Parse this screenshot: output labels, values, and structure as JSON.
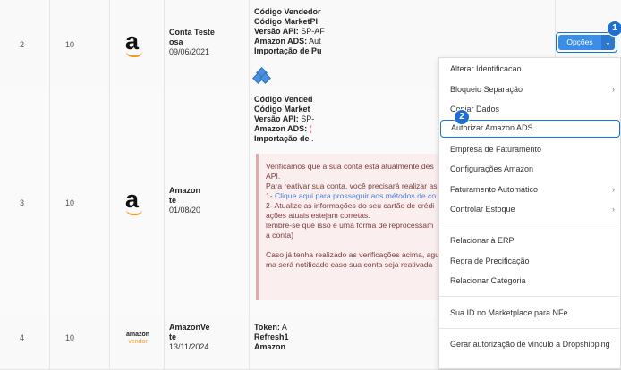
{
  "rows": [
    {
      "index": "2",
      "num": "10",
      "logo": "amazon-a",
      "account": {
        "name1": "Conta Teste",
        "name2": "osa",
        "date": "09/06/2021"
      },
      "info": [
        {
          "label": "Código Vendedor",
          "value": ""
        },
        {
          "label": "Código MarketPl",
          "value": ""
        },
        {
          "label": "Versão API:",
          "value": " SP-AF"
        },
        {
          "label": "Amazon ADS:",
          "value": " Aut"
        },
        {
          "label": "Importação de Pu",
          "value": ""
        }
      ]
    },
    {
      "index": "3",
      "num": "10",
      "logo": "amazon-a",
      "account": {
        "name1": "Amazon",
        "name2": "te",
        "date": "01/08/20"
      },
      "info": [
        {
          "label": "Código Vended",
          "value": ""
        },
        {
          "label": "Código Market",
          "value": ""
        },
        {
          "label": "Versão API:",
          "value": " SP-"
        },
        {
          "label": "Amazon ADS:",
          "value": " ("
        },
        {
          "label": "Importação de ",
          "value": "."
        }
      ],
      "warning": [
        "Verificamos que a sua conta está atualmente des",
        "API.",
        "Para reativar sua conta, você precisará realizar as",
        "1- |Clique aqui para prosseguir aos métodos de co",
        "2- Atualize as informações do seu cartão de crédi",
        "ações atuais estejam corretas.",
        "lembre-se que isso é uma forma de reprocessam",
        "a conta)",
        "",
        "Caso já tenha realizado as verificações acima, agu",
        "ma será notificado caso sua conta seja reativada"
      ]
    },
    {
      "index": "4",
      "num": "10",
      "logo": "amazon-vendor",
      "logo_text": {
        "top": "amazon",
        "bottom": "vendor"
      },
      "account": {
        "name1": "AmazonVe",
        "name2": "te",
        "date": "13/11/2024"
      },
      "info": [
        {
          "label": "Token:",
          "value": " A"
        },
        {
          "label": "Refresh1",
          "value": ""
        },
        {
          "label": "Amazon",
          "value": ""
        }
      ]
    }
  ],
  "options_button": {
    "label": "Opções",
    "caret": "⌄"
  },
  "badges": {
    "one": "1",
    "two": "2"
  },
  "menu": {
    "items": [
      {
        "label": "Alterar Identificacao",
        "submenu": false
      },
      {
        "label": "Bloqueio Separação",
        "submenu": true
      },
      {
        "label": "Copiar Dados",
        "submenu": false
      },
      {
        "label": "Autorizar Amazon ADS",
        "submenu": false,
        "highlighted": true
      },
      {
        "label": "Empresa de Faturamento",
        "submenu": false
      },
      {
        "label": "Configurações Amazon",
        "submenu": false
      },
      {
        "label": "Faturamento Automático",
        "submenu": true
      },
      {
        "label": "Controlar Estoque",
        "submenu": true
      },
      {
        "label": "Relacionar à ERP",
        "submenu": false
      },
      {
        "label": "Regra de Precificação",
        "submenu": false
      },
      {
        "label": "Relacionar Categoria",
        "submenu": false
      },
      {
        "label": "Sua ID no Marketplace para NFe",
        "submenu": false
      },
      {
        "label": "Gerar autorização de vínculo a Dropshipping",
        "submenu": false
      }
    ],
    "arrow": "›"
  },
  "colors": {
    "primary": "#3a8ee6",
    "focus": "#1a73c7",
    "warning_bg": "#fbeeee",
    "amazon_orange": "#f29a1a"
  }
}
